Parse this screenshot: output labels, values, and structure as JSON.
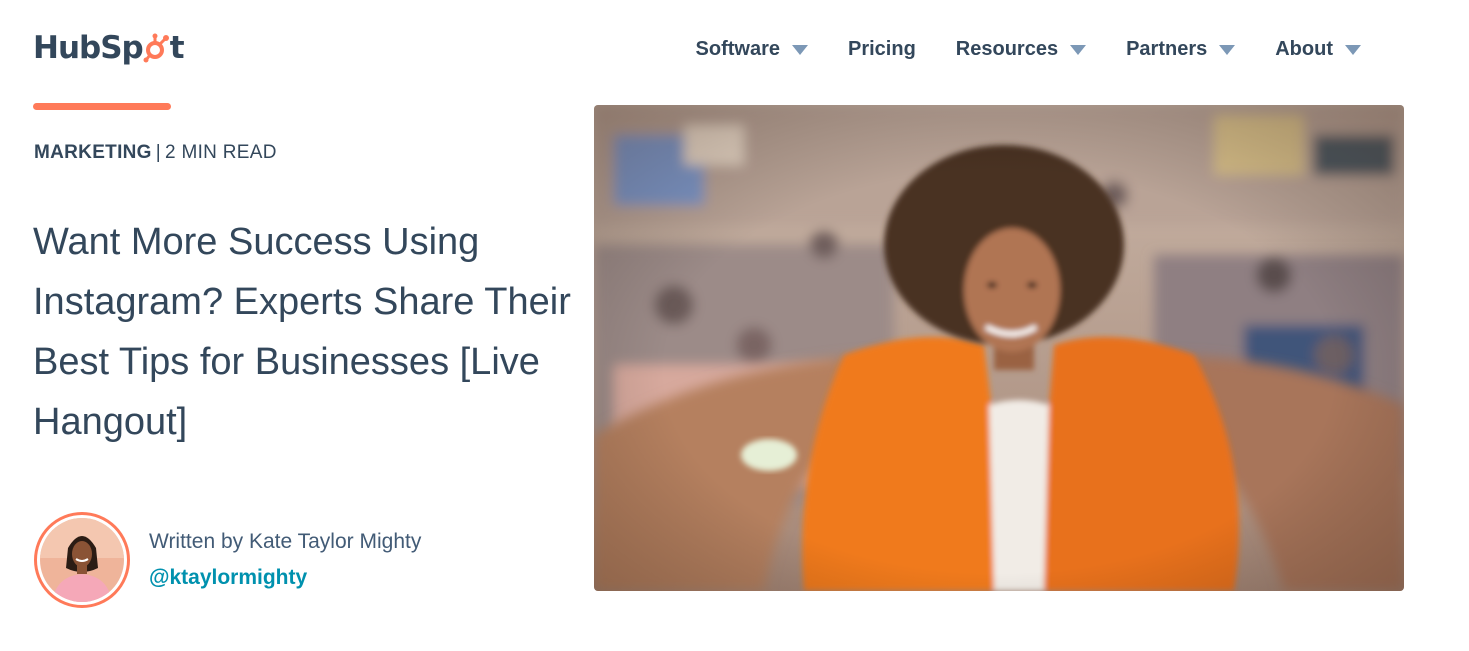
{
  "header": {
    "logo": {
      "part1": "HubSp",
      "part2": "t",
      "icon": "sprocket-icon"
    },
    "nav": [
      {
        "label": "Software",
        "has_dropdown": true
      },
      {
        "label": "Pricing",
        "has_dropdown": false
      },
      {
        "label": "Resources",
        "has_dropdown": true
      },
      {
        "label": "Partners",
        "has_dropdown": true
      },
      {
        "label": "About",
        "has_dropdown": true
      }
    ]
  },
  "article": {
    "topic": "MARKETING",
    "separator": "|",
    "read_time": "2 MIN READ",
    "title": "Want More Success Using Instagram? Experts Share Their Best Tips for Businesses [Live Hangout]",
    "author": {
      "written_by": "Written by Kate Taylor Mighty",
      "handle": "@ktaylormighty"
    },
    "hero_image": "selfie-photo-woman-orange-jacket-crowd"
  },
  "colors": {
    "accent": "#ff7a59",
    "text": "#33475b",
    "link": "#0091ae",
    "caret": "#7c98b6"
  }
}
